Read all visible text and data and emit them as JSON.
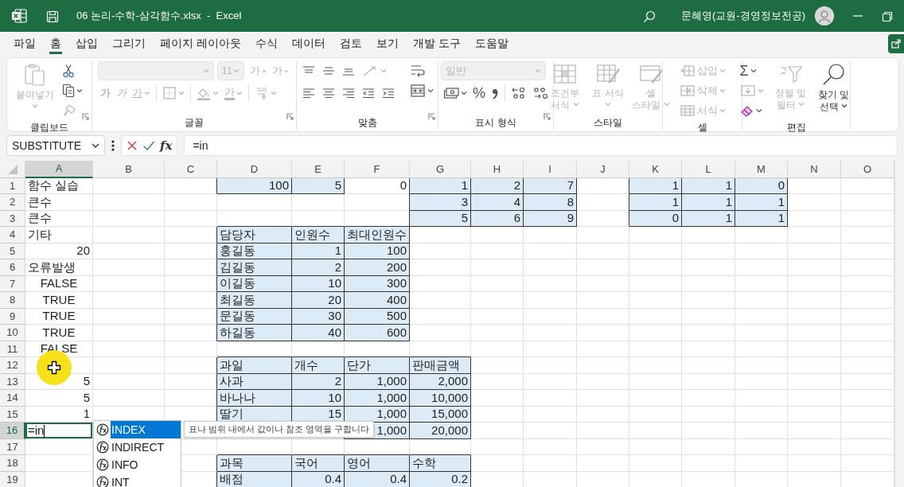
{
  "window": {
    "title": "06 논리-수학-삼각함수.xlsx  -  Excel",
    "user": "문혜영(교원-경영정보전공)"
  },
  "tabs": [
    {
      "label": "파일",
      "selected": false
    },
    {
      "label": "홈",
      "selected": true
    },
    {
      "label": "삽입",
      "selected": false
    },
    {
      "label": "그리기",
      "selected": false
    },
    {
      "label": "페이지 레이아웃",
      "selected": false
    },
    {
      "label": "수식",
      "selected": false
    },
    {
      "label": "데이터",
      "selected": false
    },
    {
      "label": "검토",
      "selected": false
    },
    {
      "label": "보기",
      "selected": false
    },
    {
      "label": "개발 도구",
      "selected": false
    },
    {
      "label": "도움말",
      "selected": false
    }
  ],
  "ribbon": {
    "groups": [
      {
        "label": "클립보드",
        "buttons": [
          {
            "label": "붙여넣기",
            "disabled": true
          },
          {
            "disabled": false
          },
          {
            "disabled": false
          },
          {
            "disabled": true
          }
        ]
      },
      {
        "label": "글꼴",
        "buttons": [
          {
            "disabled": true
          },
          {
            "value": "11",
            "disabled": true
          },
          {
            "label": "가",
            "disabled": true
          },
          {
            "label": "가",
            "disabled": true
          },
          {
            "label": "가",
            "disabled": true
          },
          {
            "label": "가",
            "disabled": true
          },
          {
            "label": "가",
            "disabled": true
          },
          {
            "disabled": true
          },
          {
            "disabled": true
          },
          {
            "label": "가",
            "disabled": true
          },
          {
            "disabled": true
          }
        ]
      },
      {
        "label": "맞춤",
        "buttons": [
          {
            "disabled": false
          },
          {
            "disabled": false
          },
          {
            "disabled": false
          },
          {
            "disabled": true
          },
          {
            "disabled": false
          },
          {
            "disabled": false
          },
          {
            "disabled": false
          },
          {
            "disabled": false
          },
          {
            "disabled": false
          },
          {
            "disabled": false
          },
          {
            "disabled": false
          }
        ]
      },
      {
        "label": "표시 형식",
        "buttons": [
          {
            "value": "일반",
            "disabled": true
          },
          {
            "disabled": false
          },
          {
            "label": "%",
            "disabled": false
          },
          {
            "disabled": false
          },
          {
            "disabled": false
          },
          {
            "disabled": false
          }
        ]
      },
      {
        "label": "스타일",
        "buttons": [
          {
            "label": "조건부 서식",
            "disabled": true
          },
          {
            "label": "표 서식",
            "disabled": true
          },
          {
            "label": "셀 스타일",
            "disabled": true
          }
        ]
      },
      {
        "label": "셀",
        "buttons": [
          {
            "label": "삽입",
            "disabled": true
          },
          {
            "label": "삭제",
            "disabled": true
          },
          {
            "label": "서식",
            "disabled": true
          }
        ]
      },
      {
        "label": "편집",
        "buttons": [
          {
            "label": "Σ",
            "disabled": false
          },
          {
            "disabled": true
          },
          {
            "disabled": false
          },
          {
            "label": "정렬 및 필터",
            "disabled": true
          },
          {
            "label": "찾기 및 선택",
            "disabled": false
          }
        ]
      }
    ]
  },
  "formula_bar": {
    "name_box": "SUBSTITUTE",
    "function_button": "fx",
    "formula": "=in"
  },
  "sheet": {
    "columns": [
      {
        "label": "A",
        "selected": true
      },
      {
        "label": "B",
        "selected": false
      },
      {
        "label": "C",
        "selected": false
      },
      {
        "label": "D",
        "selected": false
      },
      {
        "label": "E",
        "selected": false
      },
      {
        "label": "F",
        "selected": false
      },
      {
        "label": "G",
        "selected": false
      },
      {
        "label": "H",
        "selected": false
      },
      {
        "label": "I",
        "selected": false
      },
      {
        "label": "J",
        "selected": false
      },
      {
        "label": "K",
        "selected": false
      },
      {
        "label": "L",
        "selected": false
      },
      {
        "label": "M",
        "selected": false
      },
      {
        "label": "N",
        "selected": false
      },
      {
        "label": "O",
        "selected": false
      }
    ],
    "rows": [
      {
        "label": "1",
        "selected": false,
        "cells": [
          {
            "text": "함수 실습",
            "kind": "text"
          },
          null,
          null,
          {
            "text": "100",
            "kind": "number",
            "shaded": true
          },
          {
            "text": "5",
            "kind": "number",
            "shaded": true
          },
          {
            "text": "0",
            "kind": "number"
          },
          {
            "text": "1",
            "kind": "number",
            "shaded": true
          },
          {
            "text": "2",
            "kind": "number",
            "shaded": true
          },
          {
            "text": "7",
            "kind": "number",
            "shaded": true
          },
          null,
          {
            "text": "1",
            "kind": "number",
            "shaded": true
          },
          {
            "text": "1",
            "kind": "number",
            "shaded": true
          },
          {
            "text": "0",
            "kind": "number",
            "shaded": true
          }
        ]
      },
      {
        "label": "2",
        "selected": false,
        "cells": [
          {
            "text": "큰수",
            "kind": "text"
          },
          null,
          null,
          null,
          null,
          null,
          {
            "text": "3",
            "kind": "number",
            "shaded": true
          },
          {
            "text": "4",
            "kind": "number",
            "shaded": true
          },
          {
            "text": "8",
            "kind": "number",
            "shaded": true
          },
          null,
          {
            "text": "1",
            "kind": "number",
            "shaded": true
          },
          {
            "text": "1",
            "kind": "number",
            "shaded": true
          },
          {
            "text": "1",
            "kind": "number",
            "shaded": true
          }
        ]
      },
      {
        "label": "3",
        "selected": false,
        "cells": [
          {
            "text": "큰수",
            "kind": "text"
          },
          null,
          null,
          null,
          null,
          null,
          {
            "text": "5",
            "kind": "number",
            "shaded": true
          },
          {
            "text": "6",
            "kind": "number",
            "shaded": true
          },
          {
            "text": "9",
            "kind": "number",
            "shaded": true
          },
          null,
          {
            "text": "0",
            "kind": "number",
            "shaded": true
          },
          {
            "text": "1",
            "kind": "number",
            "shaded": true
          },
          {
            "text": "1",
            "kind": "number",
            "shaded": true
          }
        ]
      },
      {
        "label": "4",
        "selected": false,
        "cells": [
          {
            "text": "기타",
            "kind": "text"
          },
          null,
          null,
          {
            "text": "담당자",
            "kind": "text",
            "shaded": true
          },
          {
            "text": "인원수",
            "kind": "text",
            "shaded": true
          },
          {
            "text": "최대인원수",
            "kind": "text",
            "shaded": true
          }
        ]
      },
      {
        "label": "5",
        "selected": false,
        "cells": [
          {
            "text": "20",
            "kind": "number"
          },
          null,
          null,
          {
            "text": "홍길동",
            "kind": "text",
            "shaded": true
          },
          {
            "text": "1",
            "kind": "number",
            "shaded": true
          },
          {
            "text": "100",
            "kind": "number",
            "shaded": true
          }
        ]
      },
      {
        "label": "6",
        "selected": false,
        "cells": [
          {
            "text": "오류발생",
            "kind": "text"
          },
          null,
          null,
          {
            "text": "김길동",
            "kind": "text",
            "shaded": true
          },
          {
            "text": "2",
            "kind": "number",
            "shaded": true
          },
          {
            "text": "200",
            "kind": "number",
            "shaded": true
          }
        ]
      },
      {
        "label": "7",
        "selected": false,
        "cells": [
          {
            "text": "FALSE",
            "kind": "boolean"
          },
          null,
          null,
          {
            "text": "이길동",
            "kind": "text",
            "shaded": true
          },
          {
            "text": "10",
            "kind": "number",
            "shaded": true
          },
          {
            "text": "300",
            "kind": "number",
            "shaded": true
          }
        ]
      },
      {
        "label": "8",
        "selected": false,
        "cells": [
          {
            "text": "TRUE",
            "kind": "boolean"
          },
          null,
          null,
          {
            "text": "최길동",
            "kind": "text",
            "shaded": true
          },
          {
            "text": "20",
            "kind": "number",
            "shaded": true
          },
          {
            "text": "400",
            "kind": "number",
            "shaded": true
          }
        ]
      },
      {
        "label": "9",
        "selected": false,
        "cells": [
          {
            "text": "TRUE",
            "kind": "boolean"
          },
          null,
          null,
          {
            "text": "문길동",
            "kind": "text",
            "shaded": true
          },
          {
            "text": "30",
            "kind": "number",
            "shaded": true
          },
          {
            "text": "500",
            "kind": "number",
            "shaded": true
          }
        ]
      },
      {
        "label": "10",
        "selected": false,
        "cells": [
          {
            "text": "TRUE",
            "kind": "boolean"
          },
          null,
          null,
          {
            "text": "하길동",
            "kind": "text",
            "shaded": true
          },
          {
            "text": "40",
            "kind": "number",
            "shaded": true
          },
          {
            "text": "600",
            "kind": "number",
            "shaded": true
          }
        ]
      },
      {
        "label": "11",
        "selected": false,
        "cells": [
          {
            "text": "FALSE",
            "kind": "boolean"
          }
        ]
      },
      {
        "label": "12",
        "selected": false,
        "cells": [
          null,
          null,
          null,
          {
            "text": "과일",
            "kind": "text",
            "shaded": true
          },
          {
            "text": "개수",
            "kind": "text",
            "shaded": true
          },
          {
            "text": "단가",
            "kind": "text",
            "shaded": true
          },
          {
            "text": "판매금액",
            "kind": "text",
            "shaded": true
          }
        ]
      },
      {
        "label": "13",
        "selected": false,
        "cells": [
          {
            "text": "5",
            "kind": "number"
          },
          null,
          null,
          {
            "text": "사과",
            "kind": "text",
            "shaded": true
          },
          {
            "text": "2",
            "kind": "number",
            "shaded": true
          },
          {
            "text": "1,000",
            "kind": "number",
            "shaded": true
          },
          {
            "text": "2,000",
            "kind": "number",
            "shaded": true
          }
        ]
      },
      {
        "label": "14",
        "selected": false,
        "cells": [
          {
            "text": "5",
            "kind": "number"
          },
          null,
          null,
          {
            "text": "바나나",
            "kind": "text",
            "shaded": true
          },
          {
            "text": "10",
            "kind": "number",
            "shaded": true
          },
          {
            "text": "1,000",
            "kind": "number",
            "shaded": true
          },
          {
            "text": "10,000",
            "kind": "number",
            "shaded": true
          }
        ]
      },
      {
        "label": "15",
        "selected": false,
        "cells": [
          {
            "text": "1",
            "kind": "number"
          },
          null,
          null,
          {
            "text": "딸기",
            "kind": "text",
            "shaded": true
          },
          {
            "text": "15",
            "kind": "number",
            "shaded": true
          },
          {
            "text": "1,000",
            "kind": "number",
            "shaded": true
          },
          {
            "text": "15,000",
            "kind": "number",
            "shaded": true
          }
        ]
      },
      {
        "label": "16",
        "selected": true,
        "cells": [
          {
            "text": "=in",
            "kind": "text",
            "selected": true
          },
          null,
          null,
          null,
          null,
          {
            "text": "1,000",
            "kind": "number",
            "shaded": true
          },
          {
            "text": "20,000",
            "kind": "number",
            "shaded": true
          }
        ]
      },
      {
        "label": "17",
        "selected": false,
        "cells": []
      },
      {
        "label": "18",
        "selected": false,
        "cells": [
          null,
          null,
          null,
          {
            "text": "과목",
            "kind": "text",
            "shaded": true
          },
          {
            "text": "국어",
            "kind": "text",
            "shaded": true
          },
          {
            "text": "영어",
            "kind": "text",
            "shaded": true
          },
          {
            "text": "수학",
            "kind": "text",
            "shaded": true
          }
        ]
      },
      {
        "label": "19",
        "selected": false,
        "cells": [
          null,
          null,
          null,
          {
            "text": "배점",
            "kind": "text",
            "shaded": true
          },
          {
            "text": "0.4",
            "kind": "number",
            "shaded": true
          },
          {
            "text": "0.4",
            "kind": "number",
            "shaded": true
          },
          {
            "text": "0.2",
            "kind": "number",
            "shaded": true
          }
        ]
      }
    ]
  },
  "autocomplete": {
    "items": [
      {
        "label": "INDEX",
        "selected": true
      },
      {
        "label": "INDIRECT",
        "selected": false
      },
      {
        "label": "INFO",
        "selected": false
      },
      {
        "label": "INT",
        "selected": false
      }
    ],
    "tooltip": "표나 범위 내에서 값이나 참조 영역을 구합니다"
  }
}
